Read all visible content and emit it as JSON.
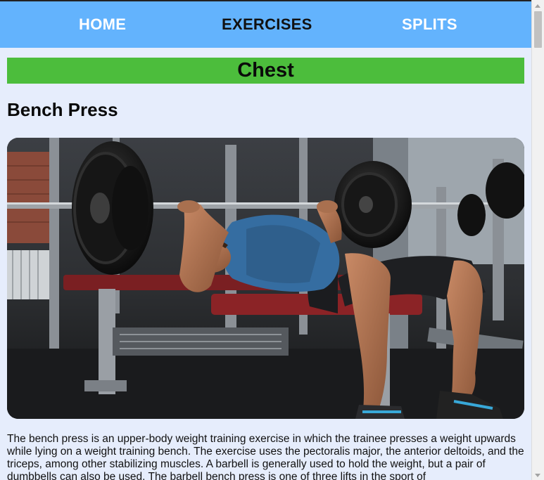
{
  "nav": {
    "home": "HOME",
    "exercises": "EXERCISES",
    "splits": "SPLITS"
  },
  "category": {
    "name": "Chest",
    "color": "#4cbd3c"
  },
  "exercise": {
    "name": "Bench Press",
    "description": "The bench press is an upper-body weight training exercise in which the trainee presses a weight upwards while lying on a weight training bench. The exercise uses the pectoralis major, the anterior deltoids, and the triceps, among other stabilizing muscles. A barbell is generally used to hold the weight, but a pair of dumbbells can also be used. The barbell bench press is one of three lifts in the sport of"
  },
  "colors": {
    "header": "#63b3fd",
    "background": "#e6edfc",
    "nav_active": "#111111",
    "nav_inactive": "#ffffff"
  }
}
